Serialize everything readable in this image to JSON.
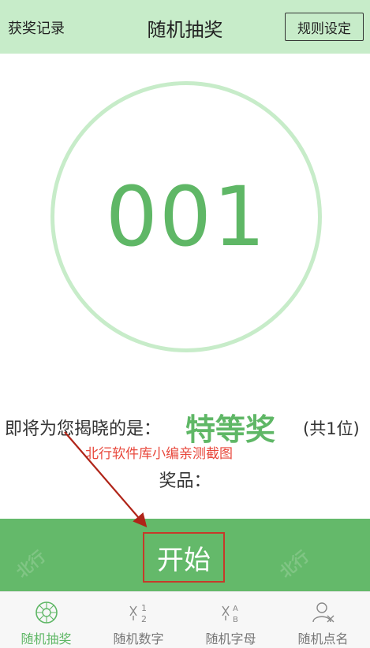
{
  "header": {
    "left_label": "获奖记录",
    "title": "随机抽奖",
    "right_button": "规则设定"
  },
  "draw": {
    "number": "001"
  },
  "reveal": {
    "prefix": "即将为您揭晓的是：",
    "prize_level": "特等奖",
    "count": "(共1位)"
  },
  "watermark": {
    "text": "北行软件库小编亲测截图",
    "side_mark": "北行"
  },
  "prize": {
    "label": "奖品："
  },
  "start": {
    "label": "开始"
  },
  "nav": {
    "items": [
      {
        "label": "随机抽奖",
        "icon": "wheel-icon",
        "active": true
      },
      {
        "label": "随机数字",
        "icon": "numbers-icon",
        "active": false
      },
      {
        "label": "随机字母",
        "icon": "letters-icon",
        "active": false
      },
      {
        "label": "随机点名",
        "icon": "person-icon",
        "active": false
      }
    ]
  },
  "colors": {
    "header_bg": "#c7ecc9",
    "accent_green": "#5fb766",
    "start_bar": "#64b96a",
    "annotation_red": "#c63a2a"
  }
}
